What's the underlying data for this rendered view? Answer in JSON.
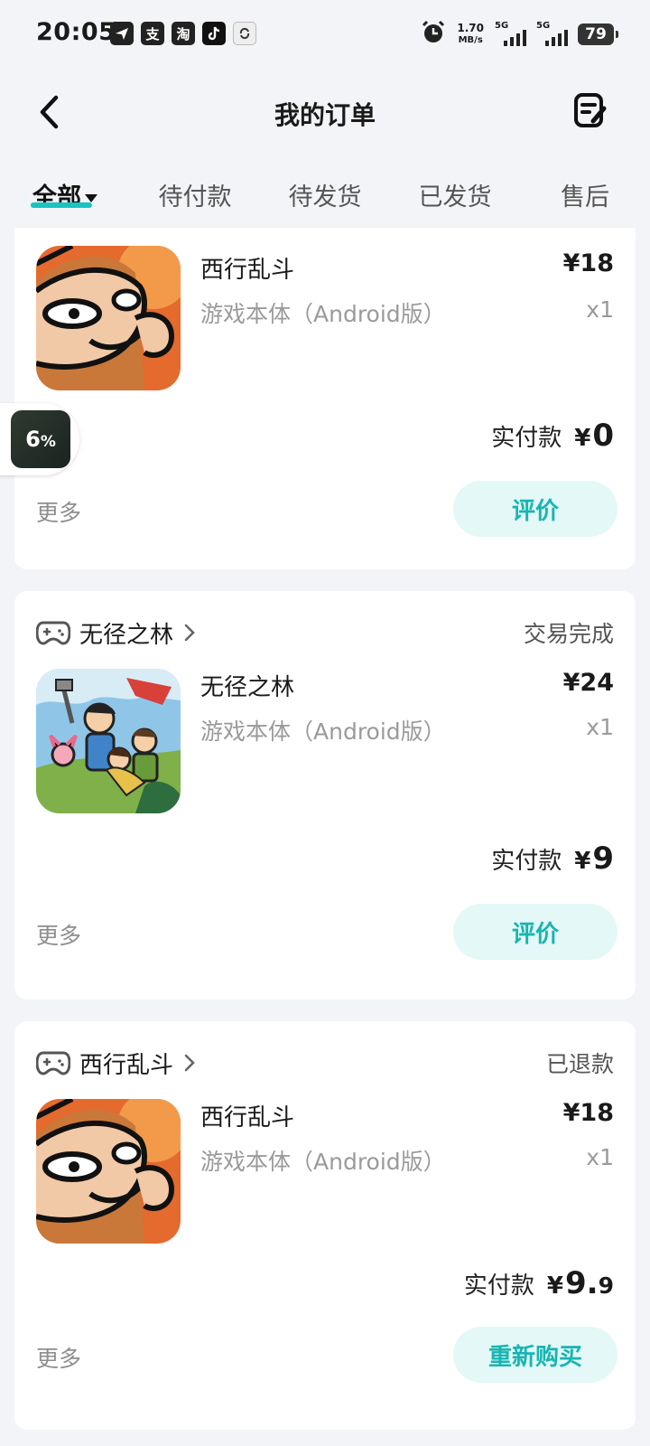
{
  "status_bar": {
    "time": "20:05",
    "speed_value": "1.70",
    "speed_unit": "MB/s",
    "net1": "5G",
    "net2": "5G",
    "battery": "79",
    "apps": [
      "飞书",
      "支",
      "淘",
      "抖音",
      "轻"
    ]
  },
  "header": {
    "title": "我的订单",
    "back_icon": "back-arrow-icon",
    "edit_icon": "edit-note-icon"
  },
  "tabs": [
    {
      "label": "全部",
      "active": true
    },
    {
      "label": "待付款",
      "active": false
    },
    {
      "label": "待发货",
      "active": false
    },
    {
      "label": "已发货",
      "active": false
    },
    {
      "label": "售后",
      "active": false
    }
  ],
  "floating_widget": {
    "progress_int": "6",
    "progress_unit": "%"
  },
  "orders": [
    {
      "shop": "",
      "status": "",
      "product": {
        "name": "西行乱斗",
        "sub": "游戏本体（Android版）",
        "price": "¥18",
        "qty": "x1"
      },
      "paid_label": "实付款",
      "paid_currency": "¥",
      "paid_int": "0",
      "paid_dec": "",
      "more": "更多",
      "action": "评价"
    },
    {
      "shop": "无径之林",
      "status": "交易完成",
      "product": {
        "name": "无径之林",
        "sub": "游戏本体（Android版）",
        "price": "¥24",
        "qty": "x1"
      },
      "paid_label": "实付款",
      "paid_currency": "¥",
      "paid_int": "9",
      "paid_dec": "",
      "more": "更多",
      "action": "评价"
    },
    {
      "shop": "西行乱斗",
      "status": "已退款",
      "product": {
        "name": "西行乱斗",
        "sub": "游戏本体（Android版）",
        "price": "¥18",
        "qty": "x1"
      },
      "paid_label": "实付款",
      "paid_currency": "¥",
      "paid_int": "9.",
      "paid_dec": "9",
      "more": "更多",
      "action": "重新购买"
    }
  ],
  "colors": {
    "accent": "#17c4c1",
    "button_bg": "#e3f8f7",
    "button_text": "#17b5b2",
    "page_bg": "#f3f4f7"
  }
}
